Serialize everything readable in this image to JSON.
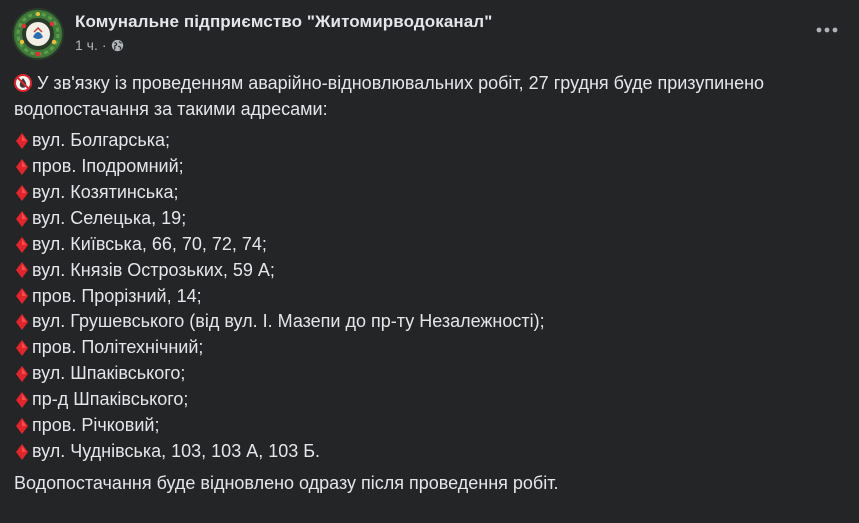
{
  "header": {
    "page_name": "Комунальне підприємство \"Житомирводоканал\"",
    "time": "1 ч.",
    "dot": "·",
    "privacy_icon": "globe-icon",
    "more_icon": "ellipsis-icon"
  },
  "post": {
    "intro_icon": "no-water-icon",
    "intro_text": "У зв'язку із проведенням аварійно-відновлювальних робіт, 27 грудня буде призупинено водопостачання за такими адресами:",
    "bullet_icon": "red-diamond-icon",
    "addresses": [
      "вул. Болгарська;",
      "пров. Іподромний;",
      "вул. Козятинська;",
      "вул. Селецька, 19;",
      "вул. Київська, 66, 70, 72, 74;",
      "вул. Князів Острозьких, 59 А;",
      "пров. Прорізний, 14;",
      "вул. Грушевського (від вул. І. Мазепи до пр-ту Незалежності);",
      "пров. Політехнічний;",
      "вул. Шпаківського;",
      "пр-д Шпаківського;",
      "пров. Річковий;",
      "вул. Чуднівська, 103, 103 А, 103 Б."
    ],
    "footer_text": "Водопостачання буде відновлено одразу після проведення робіт."
  },
  "colors": {
    "background": "#242526",
    "primary_text": "#e4e6eb",
    "secondary_text": "#b0b3b8",
    "bullet": "#e0262c"
  }
}
